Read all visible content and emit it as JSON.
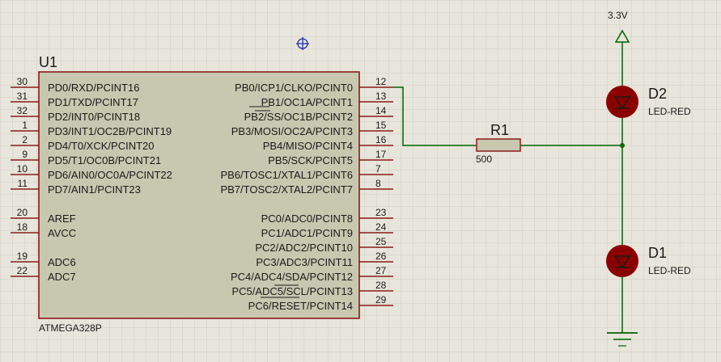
{
  "schematic": {
    "mcu": {
      "ref": "U1",
      "part": "ATMEGA328P",
      "left_pins": [
        {
          "num": "30",
          "name": "PD0/RXD/PCINT16"
        },
        {
          "num": "31",
          "name": "PD1/TXD/PCINT17"
        },
        {
          "num": "32",
          "name": "PD2/INT0/PCINT18"
        },
        {
          "num": "1",
          "name": "PD3/INT1/OC2B/PCINT19"
        },
        {
          "num": "2",
          "name": "PD4/T0/XCK/PCINT20"
        },
        {
          "num": "9",
          "name": "PD5/T1/OC0B/PCINT21"
        },
        {
          "num": "10",
          "name": "PD6/AIN0/OC0A/PCINT22"
        },
        {
          "num": "11",
          "name": "PD7/AIN1/PCINT23"
        },
        {
          "num": "20",
          "name": "AREF"
        },
        {
          "num": "18",
          "name": "AVCC"
        },
        {
          "num": "19",
          "name": "ADC6"
        },
        {
          "num": "22",
          "name": "ADC7"
        }
      ],
      "right_pins": [
        {
          "num": "12",
          "name": "PB0/ICP1/CLKO/PCINT0"
        },
        {
          "num": "13",
          "name": "PB1/OC1A/PCINT1"
        },
        {
          "num": "14",
          "name": "PB2/SS/OC1B/PCINT2"
        },
        {
          "num": "15",
          "name": "PB3/MOSI/OC2A/PCINT3"
        },
        {
          "num": "16",
          "name": "PB4/MISO/PCINT4"
        },
        {
          "num": "17",
          "name": "PB5/SCK/PCINT5"
        },
        {
          "num": "7",
          "name": "PB6/TOSC1/XTAL1/PCINT6"
        },
        {
          "num": "8",
          "name": "PB7/TOSC2/XTAL2/PCINT7"
        },
        {
          "num": "23",
          "name": "PC0/ADC0/PCINT8"
        },
        {
          "num": "24",
          "name": "PC1/ADC1/PCINT9"
        },
        {
          "num": "25",
          "name": "PC2/ADC2/PCINT10"
        },
        {
          "num": "26",
          "name": "PC3/ADC3/PCINT11"
        },
        {
          "num": "27",
          "name": "PC4/ADC4/SDA/PCINT12"
        },
        {
          "num": "28",
          "name": "PC5/ADC5/SCL/PCINT13"
        },
        {
          "num": "29",
          "name": "PC6/RESET/PCINT14"
        }
      ]
    },
    "resistor": {
      "ref": "R1",
      "value": "500"
    },
    "led_top": {
      "ref": "D2",
      "part": "LED-RED"
    },
    "led_bottom": {
      "ref": "D1",
      "part": "LED-RED"
    },
    "power": {
      "label": "3.3V"
    },
    "colors": {
      "background": "#e8e6dc",
      "grid": "#cfcdc0",
      "chip_fill": "#c8c8b0",
      "chip_border": "#8b1a1a",
      "wire": "#006400",
      "led": "#8b0000",
      "text": "#1a1a1a"
    }
  }
}
